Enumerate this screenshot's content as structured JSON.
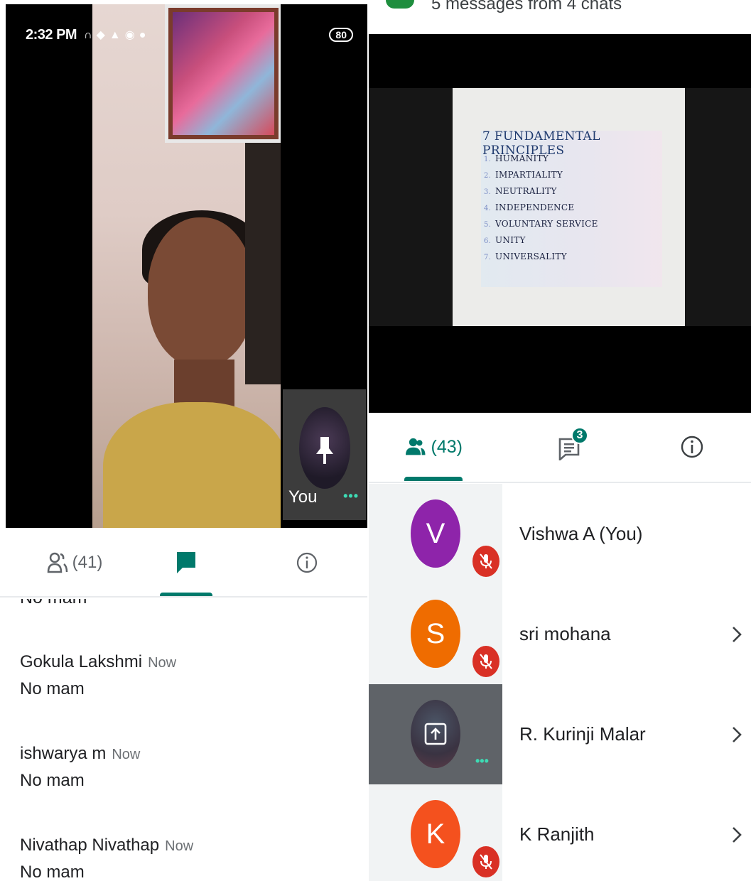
{
  "left": {
    "status_bar": {
      "time": "2:32 PM",
      "icons": [
        "headphones-icon",
        "shield-icon",
        "warning-icon",
        "location-icon",
        "location-pin-icon"
      ],
      "battery": "80"
    },
    "self_tile": {
      "label": "You"
    },
    "tabs": {
      "people_count": "(41)"
    },
    "chat": {
      "cut_text": "No mam",
      "messages": [
        {
          "name": "Gokula Lakshmi",
          "time": "Now",
          "text": "No mam"
        },
        {
          "name": "ishwarya m",
          "time": "Now",
          "text": "No mam"
        },
        {
          "name": "Nivathap Nivathap",
          "time": "Now",
          "text": "No mam"
        }
      ]
    }
  },
  "right": {
    "notification": {
      "text": "5 messages from 4 chats"
    },
    "slide": {
      "title": "7 FUNDAMENTAL PRINCIPLES",
      "items": [
        {
          "num": "1.",
          "text": "HUMANITY"
        },
        {
          "num": "2.",
          "text": "IMPARTIALITY"
        },
        {
          "num": "3.",
          "text": "NEUTRALITY"
        },
        {
          "num": "4.",
          "text": "INDEPENDENCE"
        },
        {
          "num": "5.",
          "text": "VOLUNTARY SERVICE"
        },
        {
          "num": "6.",
          "text": "UNITY"
        },
        {
          "num": "7.",
          "text": "UNIVERSALITY"
        }
      ]
    },
    "tabs": {
      "people_count": "(43)",
      "chat_badge": "3"
    },
    "participants": [
      {
        "initial": "V",
        "name": "Vishwa A (You)",
        "color": "#8e24aa",
        "muted": true
      },
      {
        "initial": "S",
        "name": "sri mohana",
        "color": "#ef6c00",
        "muted": true
      },
      {
        "initial": "",
        "name": "R. Kurinji Malar",
        "color": "#5f6368",
        "muted": false
      },
      {
        "initial": "K",
        "name": "K Ranjith",
        "color": "#f4511e",
        "muted": true
      }
    ]
  },
  "colors": {
    "accent": "#00796b",
    "mute": "#d93025",
    "speaking": "#3ddbb4"
  }
}
